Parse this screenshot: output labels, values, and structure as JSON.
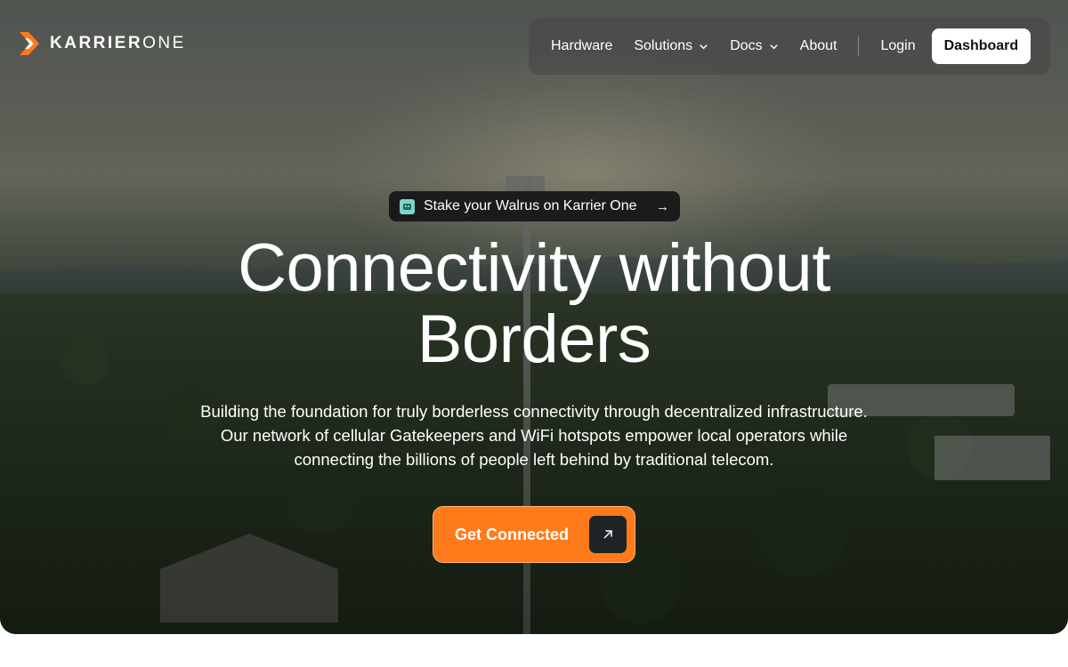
{
  "brand": {
    "name_bold": "KARRIER",
    "name_light": "ONE",
    "accent": "#ff7a1a"
  },
  "nav": {
    "items": [
      {
        "label": "Hardware",
        "has_dropdown": false
      },
      {
        "label": "Solutions",
        "has_dropdown": true
      },
      {
        "label": "Docs",
        "has_dropdown": true
      },
      {
        "label": "About",
        "has_dropdown": false
      }
    ],
    "login_label": "Login",
    "dashboard_label": "Dashboard"
  },
  "banner": {
    "text": "Stake your Walrus on Karrier One",
    "icon": "walrus-icon",
    "arrow_icon": "arrow-right-icon"
  },
  "hero": {
    "headline_line1": "Connectivity without",
    "headline_line2": "Borders",
    "subtext": "Building the foundation for truly borderless connectivity through decentralized infrastructure. Our network of cellular Gatekeepers and WiFi hotspots empower local operators while connecting the billions of people left behind by traditional telecom.",
    "cta_label": "Get Connected",
    "cta_icon": "arrow-up-right-icon"
  },
  "colors": {
    "cta": "#ff7a1a",
    "nav_bg": "#464646",
    "banner_icon": "#7fd6c8"
  }
}
